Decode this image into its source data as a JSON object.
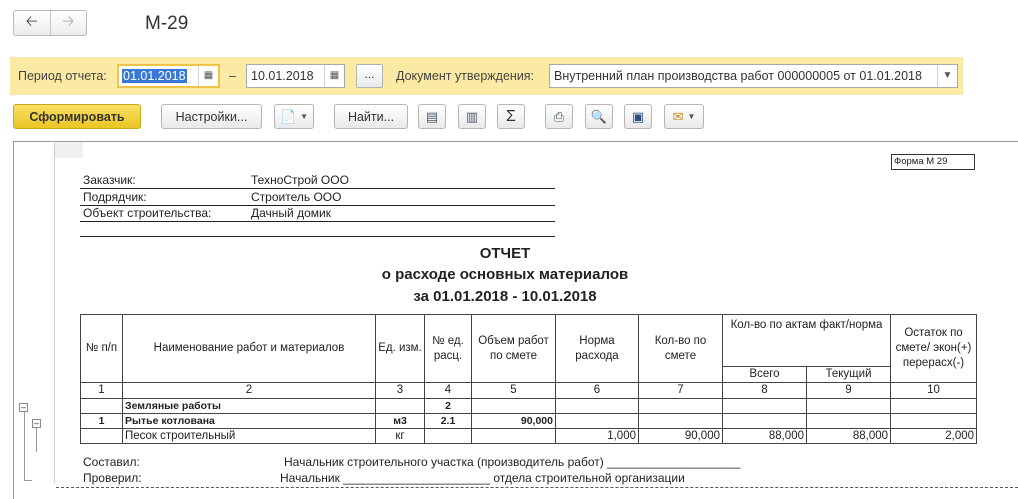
{
  "window": {
    "title": "М-29"
  },
  "nav": {
    "back_icon": "arrow-left-icon",
    "forward_icon": "arrow-right-icon"
  },
  "params": {
    "period_label": "Период отчета:",
    "date_from": "01.01.2018",
    "dash": "–",
    "date_to": "10.01.2018",
    "dots": "...",
    "doc_label": "Документ утверждения:",
    "doc_value": "Внутренний план производства работ 000000005 от 01.01.2018"
  },
  "toolbar": {
    "generate": "Сформировать",
    "settings": "Настройки...",
    "find": "Найти..."
  },
  "report": {
    "form_label": "Форма М 29",
    "customer_label": "Заказчик:",
    "customer_value": "ТехноСтрой ООО",
    "contractor_label": "Подрядчик:",
    "contractor_value": "Строитель ООО",
    "object_label": "Объект строительства:",
    "object_value": "Дачный домик",
    "title1": "ОТЧЕТ",
    "title2": "о расходе основных материалов",
    "title3": "за 01.01.2018 - 10.01.2018",
    "headers": {
      "num": "№ п/п",
      "name": "Наименование работ и материалов",
      "unit": "Ед. изм.",
      "est_num": "№ ед. расц.",
      "volume": "Объем работ по смете",
      "norm": "Норма расхода",
      "qty_est": "Кол-во по смете",
      "qty_acts": "Кол-во по актам факт/норма",
      "total": "Всего",
      "current": "Текущий",
      "rest": "Остаток по смете/ экон(+) перерасх(-)"
    },
    "col_numbers": [
      "1",
      "2",
      "3",
      "4",
      "5",
      "6",
      "7",
      "8",
      "9",
      "10"
    ],
    "rows": [
      {
        "num": "",
        "name": "Земляные работы",
        "unit": "",
        "est": "2",
        "volume": "",
        "norm": "",
        "qty_est": "",
        "total": "",
        "current": "",
        "rest": ""
      },
      {
        "num": "1",
        "name": "Рытье котлована",
        "unit": "м3",
        "est": "2.1",
        "volume": "90,000",
        "norm": "",
        "qty_est": "",
        "total": "",
        "current": "",
        "rest": ""
      },
      {
        "num": "",
        "name": "Песок строительный",
        "unit": "кг",
        "est": "",
        "volume": "",
        "norm": "1,000",
        "qty_est": "90,000",
        "total": "88,000",
        "current": "88,000",
        "rest": "2,000"
      }
    ],
    "compiled_label": "Составил:",
    "compiled_value": "Начальник строительного участка (производитель работ) ____________________",
    "checked_label": "Проверил:",
    "checked_value": "Начальник ______________________ отдела строительной организации"
  }
}
